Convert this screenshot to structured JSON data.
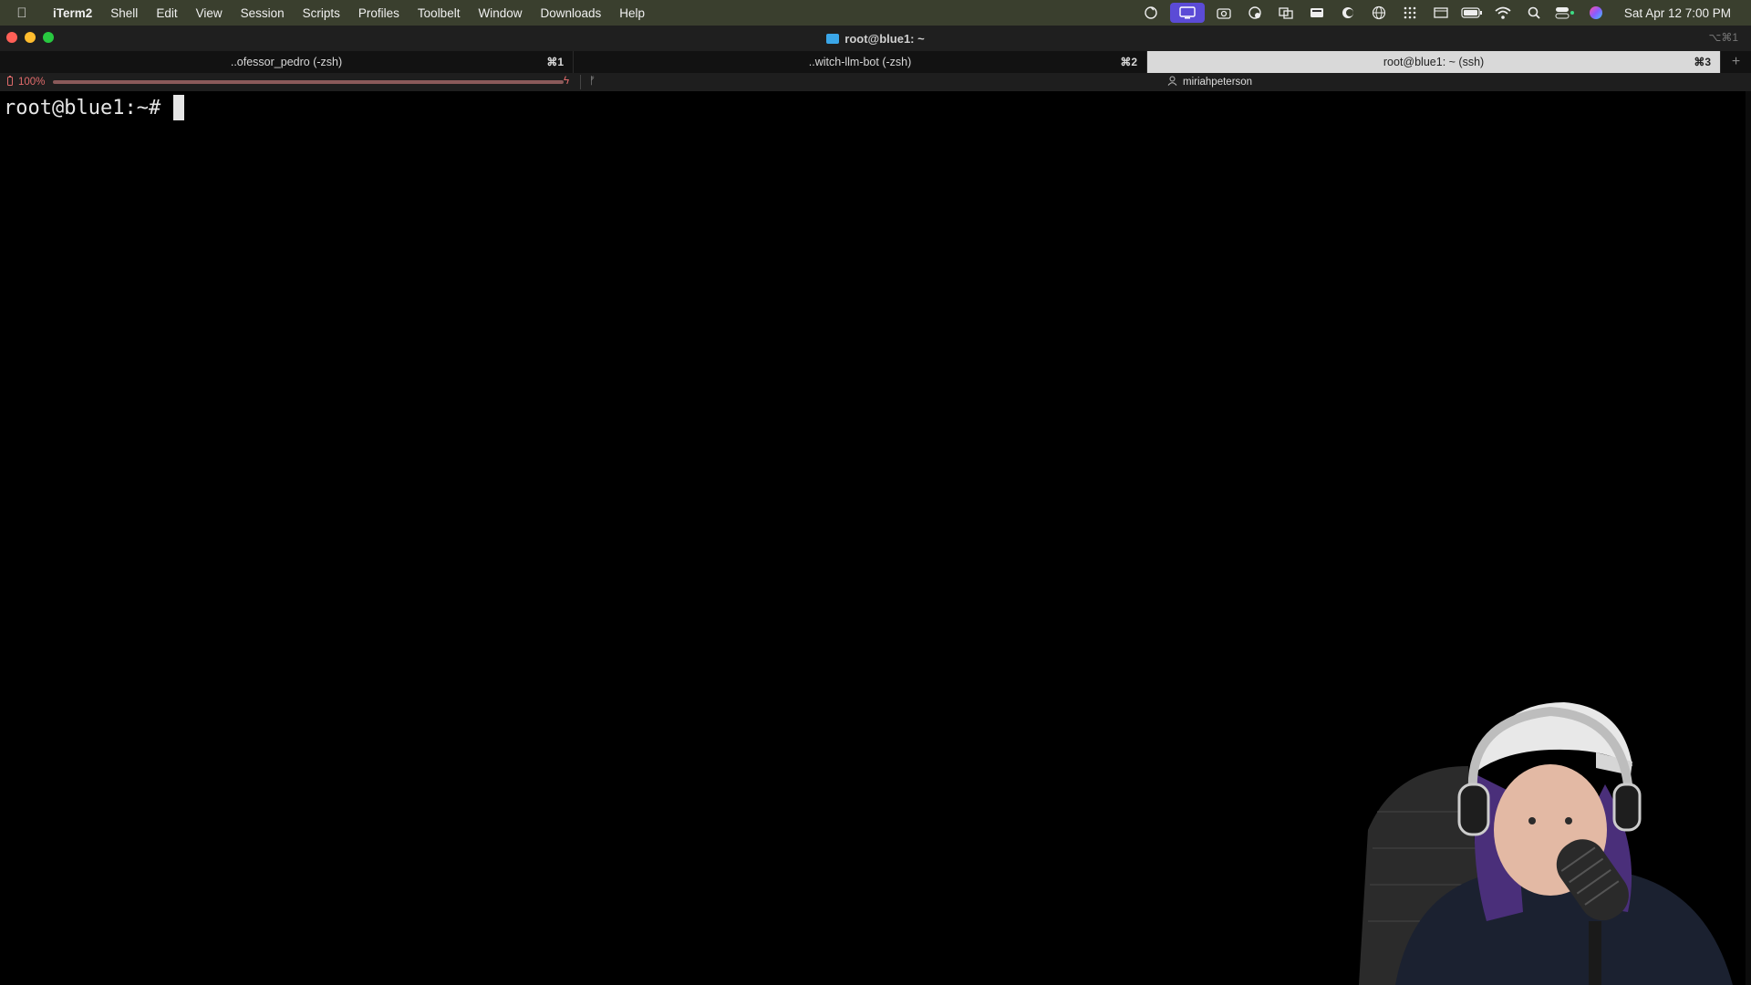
{
  "menubar": {
    "apple_icon": "apple-icon",
    "app_name": "iTerm2",
    "menus": [
      "Shell",
      "Edit",
      "View",
      "Session",
      "Scripts",
      "Profiles",
      "Toolbelt",
      "Window",
      "Downloads",
      "Help"
    ],
    "status_icons": [
      "sync-icon",
      "screen-share-icon",
      "camera-icon",
      "vpn-icon",
      "mirror-icon",
      "keyboard-icon",
      "dark-mode-icon",
      "globe-icon",
      "grid-icon",
      "window-icon",
      "battery-icon",
      "wifi-icon",
      "search-icon",
      "control-center-icon",
      "siri-icon"
    ],
    "clock": "Sat Apr 12  7:00 PM"
  },
  "window": {
    "title": "root@blue1: ~",
    "shortcut": "⌥⌘1"
  },
  "tabs": [
    {
      "label": "..ofessor_pedro (-zsh)",
      "shortcut": "⌘1",
      "active": false
    },
    {
      "label": "..witch-llm-bot (-zsh)",
      "shortcut": "⌘2",
      "active": false
    },
    {
      "label": "root@blue1: ~ (ssh)",
      "shortcut": "⌘3",
      "active": true
    }
  ],
  "statusbar": {
    "battery_percent": "100%",
    "battery_level": 1.0,
    "user": "miriahpeterson"
  },
  "terminal": {
    "prompt": "root@blue1:~#"
  },
  "colors": {
    "menubar_bg": "#3a3f2e",
    "accent": "#5b4bd6",
    "folder": "#3aa6e8"
  }
}
